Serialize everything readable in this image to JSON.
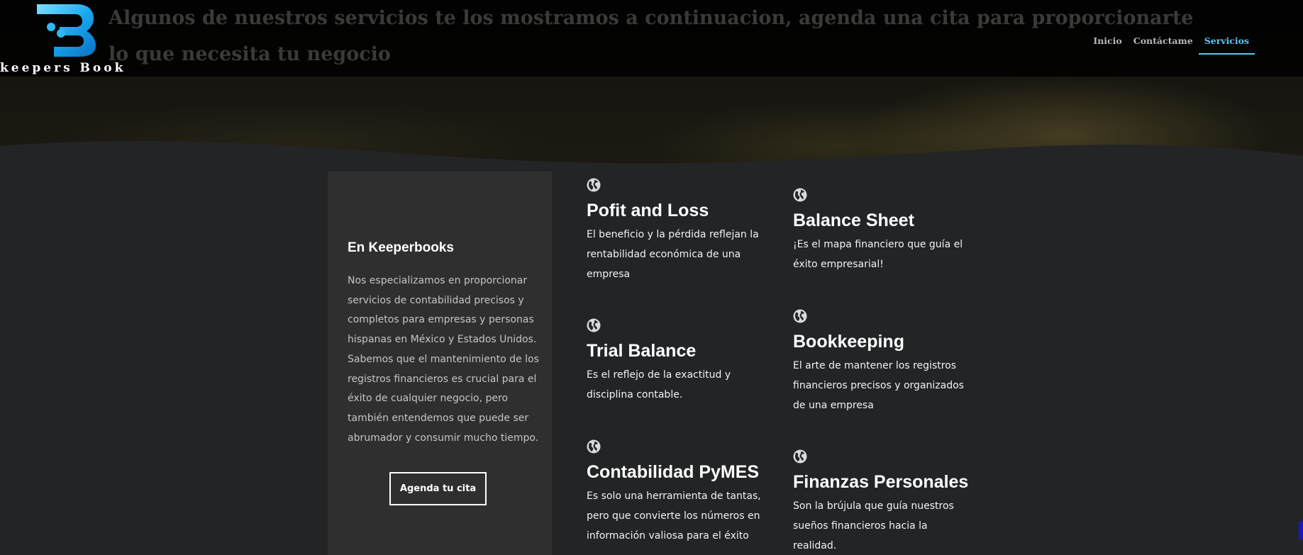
{
  "header": {
    "logo_text": "keepers Book",
    "hero_title": "Algunos de nuestros servicios te los mostramos a continuacion, agenda una cita para proporcionarte lo que necesita tu negocio",
    "nav": [
      {
        "label": "Inicio",
        "active": false
      },
      {
        "label": "Contáctame",
        "active": false
      },
      {
        "label": "Servicios",
        "active": true
      }
    ]
  },
  "intro_card": {
    "title": "En Keeperbooks",
    "text": "Nos especializamos en proporcionar servicios de contabilidad precisos y completos para empresas y personas hispanas en México y Estados Unidos. Sabemos que el mantenimiento de los registros financieros es crucial para el éxito de cualquier negocio, pero también entendemos que puede ser abrumador y consumir mucho tiempo.",
    "button_label": "Agenda tu cita"
  },
  "services": [
    {
      "icon": "globe-icon",
      "title": "Pofit and Loss",
      "text": "El beneficio y la pérdida reflejan la rentabilidad económica de una empresa"
    },
    {
      "icon": "globe-icon",
      "title": "Trial Balance",
      "text": "Es el reflejo de la exactitud y disciplina contable."
    },
    {
      "icon": "globe-icon",
      "title": "Contabilidad PyMES",
      "text": "Es solo una herramienta de tantas, pero que convierte los números en información valiosa para el éxito"
    },
    {
      "icon": "globe-icon",
      "title": "Balance Sheet",
      "text": "¡Es el mapa financiero que guía el éxito empresarial!"
    },
    {
      "icon": "globe-icon",
      "title": "Bookkeeping",
      "text": "El arte de mantener los registros financieros precisos y organizados de una empresa"
    },
    {
      "icon": "globe-icon",
      "title": "Finanzas Personales",
      "text": "Son la brújula que guía nuestros sueños financieros hacia la realidad."
    }
  ],
  "colors": {
    "accent": "#5cc6f5",
    "background": "#232425",
    "card": "#2f2f30"
  }
}
